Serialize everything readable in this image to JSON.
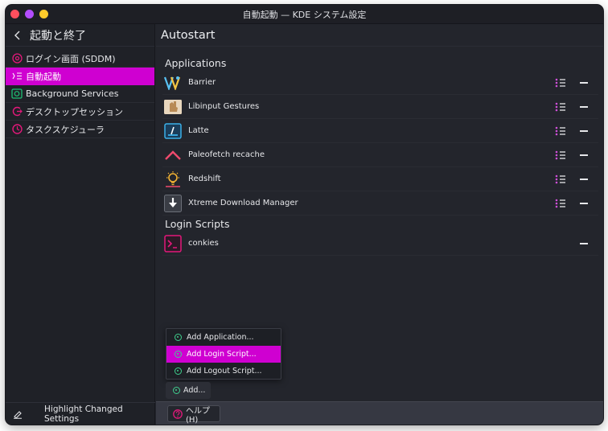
{
  "window": {
    "title": "自動起動 — KDE システム設定"
  },
  "sidebar": {
    "title": "起動と終了",
    "items": [
      {
        "label": "ログイン画面 (SDDM)",
        "icon": "login-screen-icon",
        "color": "#e3187a"
      },
      {
        "label": "自動起動",
        "icon": "autostart-icon",
        "color": "#ffffff",
        "active": true
      },
      {
        "label": "Background Services",
        "icon": "background-services-icon",
        "color": "#1dbf73"
      },
      {
        "label": "デスクトップセッション",
        "icon": "desktop-session-icon",
        "color": "#e3187a"
      },
      {
        "label": "タスクスケジューラ",
        "icon": "task-scheduler-icon",
        "color": "#e3187a"
      }
    ],
    "footer_label": "Highlight Changed Settings"
  },
  "main": {
    "title": "Autostart",
    "sections": {
      "applications": {
        "label": "Applications",
        "items": [
          {
            "label": "Barrier",
            "icon": "barrier-icon"
          },
          {
            "label": "Libinput Gestures",
            "icon": "libinput-gestures-icon"
          },
          {
            "label": "Latte",
            "icon": "latte-icon"
          },
          {
            "label": "Paleofetch recache",
            "icon": "paleofetch-icon"
          },
          {
            "label": "Redshift",
            "icon": "redshift-icon"
          },
          {
            "label": "Xtreme Download Manager",
            "icon": "xdm-icon"
          }
        ]
      },
      "login_scripts": {
        "label": "Login Scripts",
        "items": [
          {
            "label": "conkies",
            "icon": "terminal-icon"
          }
        ]
      }
    },
    "add_menu": {
      "items": [
        {
          "label": "Add Application..."
        },
        {
          "label": "Add Login Script...",
          "active": true
        },
        {
          "label": "Add Logout Script..."
        }
      ],
      "button_label": "Add..."
    },
    "help_label": "ヘルプ(H)"
  },
  "colors": {
    "accent": "#cf00d1",
    "background": "#23252c",
    "sidebar": "#1f2127",
    "footer": "#363842"
  }
}
